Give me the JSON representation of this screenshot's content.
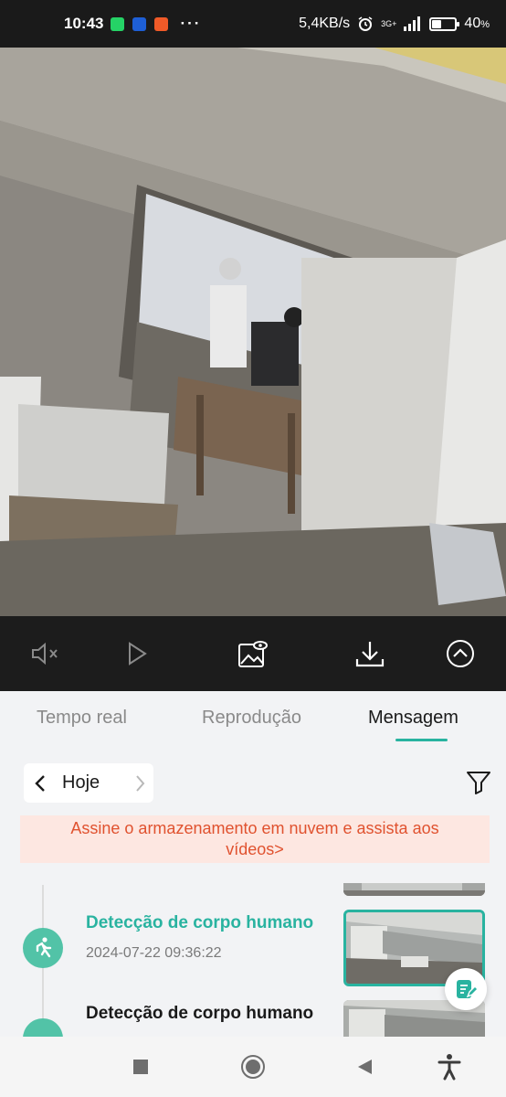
{
  "status_bar": {
    "time": "10:43",
    "apps": [
      "whatsapp-icon",
      "phone-app-icon",
      "notification-app-icon"
    ],
    "more": "···",
    "network_speed": "5,4KB/s",
    "network_type": "3G+",
    "battery": "40",
    "battery_unit": "%",
    "battery_level": 0.4
  },
  "camera": {
    "description_icon": "camera-feed-image"
  },
  "controls": {
    "mute_icon": "speaker-muted-icon",
    "play_icon": "play-icon",
    "snapshot_icon": "image-snapshot-icon",
    "download_icon": "download-icon",
    "collapse_icon": "chevron-up-circle-icon"
  },
  "tabs": [
    {
      "label": "Tempo real",
      "active": false
    },
    {
      "label": "Reprodução",
      "active": false
    },
    {
      "label": "Mensagem",
      "active": true
    }
  ],
  "date_picker": {
    "label": "Hoje"
  },
  "banner": {
    "line1": "Assine o armazenamento em nuvem e assista aos",
    "line2": "vídeos>"
  },
  "events": [
    {
      "title": "Detecção de corpo humano",
      "time": "2024-07-22 09:36:22",
      "highlighted": true
    },
    {
      "title": "Detecção de corpo humano",
      "time": "",
      "highlighted": false
    }
  ],
  "colors": {
    "accent": "#29b3a0",
    "event_icon": "#52c3a7",
    "banner_bg": "#fde7e1",
    "banner_text": "#e0522f",
    "dark": "#1c1c1c"
  }
}
